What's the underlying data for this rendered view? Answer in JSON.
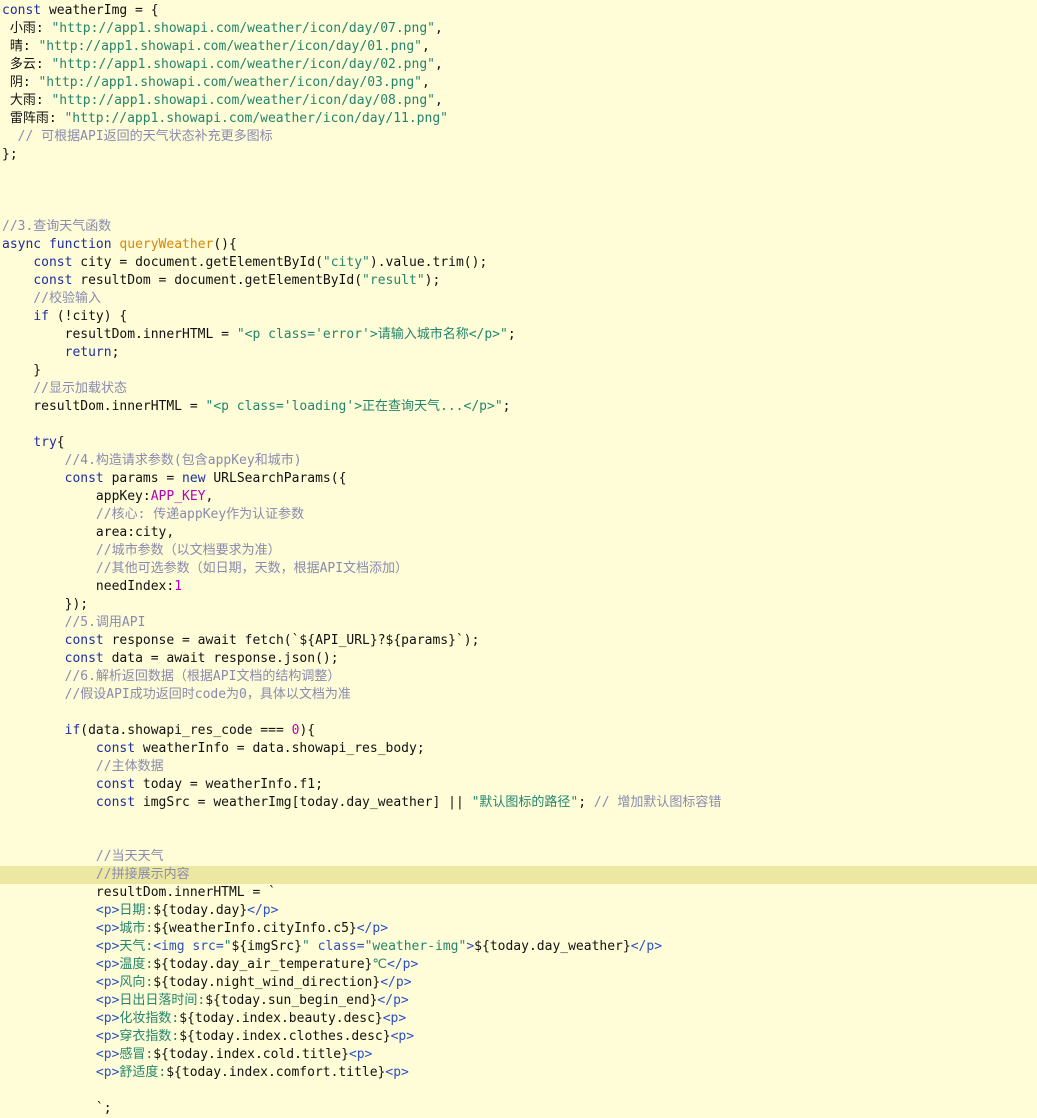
{
  "lines": [
    [
      [
        "kw",
        "const"
      ],
      [
        "pl",
        " weatherImg = {"
      ]
    ],
    [
      [
        "pl",
        " 小雨: "
      ],
      [
        "str",
        "\"http://app1.showapi.com/weather/icon/day/07.png\""
      ],
      [
        "pl",
        ","
      ]
    ],
    [
      [
        "pl",
        " 晴: "
      ],
      [
        "str",
        "\"http://app1.showapi.com/weather/icon/day/01.png\""
      ],
      [
        "pl",
        ","
      ]
    ],
    [
      [
        "pl",
        " 多云: "
      ],
      [
        "str",
        "\"http://app1.showapi.com/weather/icon/day/02.png\""
      ],
      [
        "pl",
        ","
      ]
    ],
    [
      [
        "pl",
        " 阴: "
      ],
      [
        "str",
        "\"http://app1.showapi.com/weather/icon/day/03.png\""
      ],
      [
        "pl",
        ","
      ]
    ],
    [
      [
        "pl",
        " 大雨: "
      ],
      [
        "str",
        "\"http://app1.showapi.com/weather/icon/day/08.png\""
      ],
      [
        "pl",
        ","
      ]
    ],
    [
      [
        "pl",
        " 雷阵雨: "
      ],
      [
        "str",
        "\"http://app1.showapi.com/weather/icon/day/11.png\""
      ]
    ],
    [
      [
        "cm",
        "  // 可根据API返回的天气状态补充更多图标"
      ]
    ],
    [
      [
        "pl",
        "};"
      ]
    ],
    [],
    [],
    [],
    [
      [
        "cm",
        "//3.查询天气函数"
      ]
    ],
    [
      [
        "kw",
        "async"
      ],
      [
        "pl",
        " "
      ],
      [
        "kw",
        "function"
      ],
      [
        "pl",
        " "
      ],
      [
        "fn",
        "queryWeather"
      ],
      [
        "pl",
        "(){"
      ]
    ],
    [
      [
        "pl",
        "    "
      ],
      [
        "kw",
        "const"
      ],
      [
        "pl",
        " city = document.getElementById("
      ],
      [
        "str",
        "\"city\""
      ],
      [
        "pl",
        ").value.trim();"
      ]
    ],
    [
      [
        "pl",
        "    "
      ],
      [
        "kw",
        "const"
      ],
      [
        "pl",
        " resultDom = document.getElementById("
      ],
      [
        "str",
        "\"result\""
      ],
      [
        "pl",
        ");"
      ]
    ],
    [
      [
        "cm",
        "    //校验输入"
      ]
    ],
    [
      [
        "pl",
        "    "
      ],
      [
        "kw",
        "if"
      ],
      [
        "pl",
        " (!city) {"
      ]
    ],
    [
      [
        "pl",
        "        resultDom.innerHTML = "
      ],
      [
        "str",
        "\"<p class='error'>请输入城市名称</p>\""
      ],
      [
        "pl",
        ";"
      ]
    ],
    [
      [
        "pl",
        "        "
      ],
      [
        "kw",
        "return"
      ],
      [
        "pl",
        ";"
      ]
    ],
    [
      [
        "pl",
        "    }"
      ]
    ],
    [
      [
        "cm",
        "    //显示加载状态"
      ]
    ],
    [
      [
        "pl",
        "    resultDom.innerHTML = "
      ],
      [
        "str",
        "\"<p class='loading'>正在查询天气...</p>\""
      ],
      [
        "pl",
        ";"
      ]
    ],
    [],
    [
      [
        "pl",
        "    "
      ],
      [
        "kw",
        "try"
      ],
      [
        "pl",
        "{"
      ]
    ],
    [
      [
        "cm",
        "        //4.构造请求参数(包含appKey和城市)"
      ]
    ],
    [
      [
        "pl",
        "        "
      ],
      [
        "kw",
        "const"
      ],
      [
        "pl",
        " params = "
      ],
      [
        "kw",
        "new"
      ],
      [
        "pl",
        " URLSearchParams({"
      ]
    ],
    [
      [
        "pl",
        "            appKey:"
      ],
      [
        "cn",
        "APP_KEY"
      ],
      [
        "pl",
        ","
      ]
    ],
    [
      [
        "cm",
        "            //核心: 传递appKey作为认证参数"
      ]
    ],
    [
      [
        "pl",
        "            area:city,"
      ]
    ],
    [
      [
        "cm",
        "            //城市参数（以文档要求为准）"
      ]
    ],
    [
      [
        "cm",
        "            //其他可选参数（如日期，天数，根据API文档添加）"
      ]
    ],
    [
      [
        "pl",
        "            needIndex:"
      ],
      [
        "nm",
        "1"
      ]
    ],
    [
      [
        "pl",
        "        });"
      ]
    ],
    [
      [
        "cm",
        "        //5.调用API"
      ]
    ],
    [
      [
        "pl",
        "        "
      ],
      [
        "kw",
        "const"
      ],
      [
        "pl",
        " response = await fetch(`${API_URL}?${params}`);"
      ]
    ],
    [
      [
        "pl",
        "        "
      ],
      [
        "kw",
        "const"
      ],
      [
        "pl",
        " data = await response.json();"
      ]
    ],
    [
      [
        "cm",
        "        //6.解析返回数据（根据API文档的结构调整）"
      ]
    ],
    [
      [
        "cm",
        "        //假设API成功返回时code为0，具体以文档为准"
      ]
    ],
    [],
    [
      [
        "pl",
        "        "
      ],
      [
        "kw",
        "if"
      ],
      [
        "pl",
        "(data.showapi_res_code === "
      ],
      [
        "nm",
        "0"
      ],
      [
        "pl",
        "){"
      ]
    ],
    [
      [
        "pl",
        "            "
      ],
      [
        "kw",
        "const"
      ],
      [
        "pl",
        " weatherInfo = data.showapi_res_body;"
      ]
    ],
    [
      [
        "cm",
        "            //主体数据"
      ]
    ],
    [
      [
        "pl",
        "            "
      ],
      [
        "kw",
        "const"
      ],
      [
        "pl",
        " today = weatherInfo.f1;"
      ]
    ],
    [
      [
        "pl",
        "            "
      ],
      [
        "kw",
        "const"
      ],
      [
        "pl",
        " imgSrc = weatherImg[today.day_weather] || "
      ],
      [
        "str",
        "\"默认图标的路径\""
      ],
      [
        "pl",
        "; "
      ],
      [
        "cm",
        "// 增加默认图标容错"
      ]
    ],
    [],
    [],
    [
      [
        "cm",
        "            //当天天气"
      ]
    ],
    [
      [
        "cm",
        "            //拼接展示内容"
      ]
    ],
    [
      [
        "pl",
        "            resultDom.innerHTML = `"
      ]
    ],
    [
      [
        "pl",
        "            "
      ],
      [
        "tg",
        "<p>"
      ],
      [
        "str",
        "日期:"
      ],
      [
        "pl",
        "${today.day}"
      ],
      [
        "tg",
        "</p>"
      ]
    ],
    [
      [
        "pl",
        "            "
      ],
      [
        "tg",
        "<p>"
      ],
      [
        "str",
        "城市:"
      ],
      [
        "pl",
        "${weatherInfo.cityInfo.c5}"
      ],
      [
        "tg",
        "</p>"
      ]
    ],
    [
      [
        "pl",
        "            "
      ],
      [
        "tg",
        "<p>"
      ],
      [
        "str",
        "天气:"
      ],
      [
        "tg",
        "<img src="
      ],
      [
        "str",
        "\""
      ],
      [
        "pl",
        "${imgSrc}"
      ],
      [
        "str",
        "\""
      ],
      [
        "tg",
        " class="
      ],
      [
        "str",
        "\"weather-img\""
      ],
      [
        "tg",
        ">"
      ],
      [
        "pl",
        "${today.day_weather}"
      ],
      [
        "tg",
        "</p>"
      ]
    ],
    [
      [
        "pl",
        "            "
      ],
      [
        "tg",
        "<p>"
      ],
      [
        "str",
        "温度:"
      ],
      [
        "pl",
        "${today.day_air_temperature}"
      ],
      [
        "str",
        "℃"
      ],
      [
        "tg",
        "</p>"
      ]
    ],
    [
      [
        "pl",
        "            "
      ],
      [
        "tg",
        "<p>"
      ],
      [
        "str",
        "风向:"
      ],
      [
        "pl",
        "${today.night_wind_direction}"
      ],
      [
        "tg",
        "</p>"
      ]
    ],
    [
      [
        "pl",
        "            "
      ],
      [
        "tg",
        "<p>"
      ],
      [
        "str",
        "日出日落时间:"
      ],
      [
        "pl",
        "${today.sun_begin_end}"
      ],
      [
        "tg",
        "</p>"
      ]
    ],
    [
      [
        "pl",
        "            "
      ],
      [
        "tg",
        "<p>"
      ],
      [
        "str",
        "化妆指数:"
      ],
      [
        "pl",
        "${today.index.beauty.desc}"
      ],
      [
        "tg",
        "<p>"
      ]
    ],
    [
      [
        "pl",
        "            "
      ],
      [
        "tg",
        "<p>"
      ],
      [
        "str",
        "穿衣指数:"
      ],
      [
        "pl",
        "${today.index.clothes.desc}"
      ],
      [
        "tg",
        "<p>"
      ]
    ],
    [
      [
        "pl",
        "            "
      ],
      [
        "tg",
        "<p>"
      ],
      [
        "str",
        "感冒:"
      ],
      [
        "pl",
        "${today.index.cold.title}"
      ],
      [
        "tg",
        "<p>"
      ]
    ],
    [
      [
        "pl",
        "            "
      ],
      [
        "tg",
        "<p>"
      ],
      [
        "str",
        "舒适度:"
      ],
      [
        "pl",
        "${today.index.comfort.title}"
      ],
      [
        "tg",
        "<p>"
      ]
    ],
    [],
    [
      [
        "pl",
        "            `;"
      ]
    ]
  ]
}
